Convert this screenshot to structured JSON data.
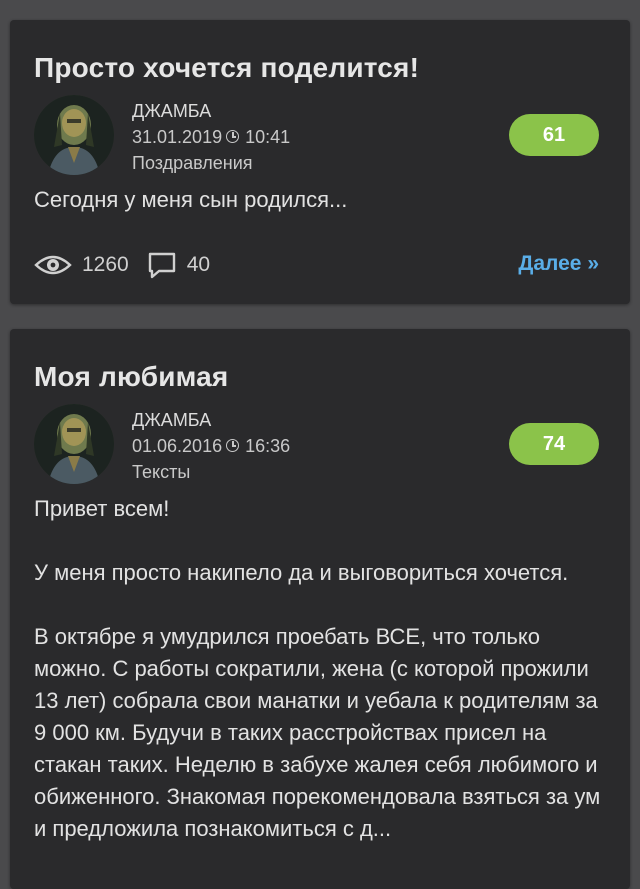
{
  "posts": [
    {
      "title": "Просто хочется поделится!",
      "author": "ДЖАМБА",
      "date": "31.01.2019",
      "time": "10:41",
      "category": "Поздравления",
      "rating": "61",
      "excerpt": "Сегодня у меня сын родился...",
      "views": "1260",
      "comments": "40",
      "more_label": "Далее »"
    },
    {
      "title": "Моя любимая",
      "author": "ДЖАМБА",
      "date": "01.06.2016",
      "time": "16:36",
      "category": "Тексты",
      "rating": "74",
      "paragraphs": [
        "Привет всем!",
        "У меня просто накипело да и выговориться хочется.",
        "В октябре я умудрился проебать ВСЕ, что только можно. С работы сократили, жена (с которой прожили 13 лет) собрала свои манатки и уебала к родителям за 9 000 км. Будучи в таких расстройствах присел на стакан таких. Неделю в забухе жалея себя любимого и обиженного. Знакомая порекомендовала взяться за ум и предложила познакомиться с д..."
      ]
    }
  ],
  "colors": {
    "background": "#4a4a4c",
    "card": "#2a2a2c",
    "rating_badge": "#8bc34a",
    "link": "#5aaee8"
  },
  "icons": {
    "views": "eye-icon",
    "comments": "comment-icon",
    "time": "clock-icon"
  }
}
